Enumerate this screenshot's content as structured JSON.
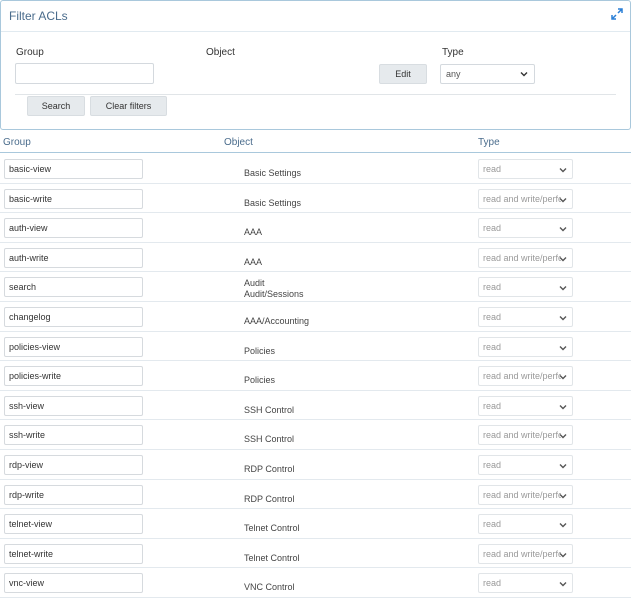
{
  "filter": {
    "title": "Filter ACLs",
    "group_label": "Group",
    "object_label": "Object",
    "type_label": "Type",
    "group_value": "",
    "edit_label": "Edit",
    "type_value": "any",
    "search_label": "Search",
    "clear_label": "Clear filters"
  },
  "table": {
    "headers": {
      "group": "Group",
      "object": "Object",
      "type": "Type"
    },
    "rows": [
      {
        "group": "basic-view",
        "object": "Basic Settings",
        "object2": "",
        "type": "read"
      },
      {
        "group": "basic-write",
        "object": "Basic Settings",
        "object2": "",
        "type": "read and write/perform"
      },
      {
        "group": "auth-view",
        "object": "AAA",
        "object2": "",
        "type": "read"
      },
      {
        "group": "auth-write",
        "object": "AAA",
        "object2": "",
        "type": "read and write/perform"
      },
      {
        "group": "search",
        "object": "Audit",
        "object2": "Audit/Sessions",
        "type": "read"
      },
      {
        "group": "changelog",
        "object": "AAA/Accounting",
        "object2": "",
        "type": "read"
      },
      {
        "group": "policies-view",
        "object": "Policies",
        "object2": "",
        "type": "read"
      },
      {
        "group": "policies-write",
        "object": "Policies",
        "object2": "",
        "type": "read and write/perform"
      },
      {
        "group": "ssh-view",
        "object": "SSH Control",
        "object2": "",
        "type": "read"
      },
      {
        "group": "ssh-write",
        "object": "SSH Control",
        "object2": "",
        "type": "read and write/perform"
      },
      {
        "group": "rdp-view",
        "object": "RDP Control",
        "object2": "",
        "type": "read"
      },
      {
        "group": "rdp-write",
        "object": "RDP Control",
        "object2": "",
        "type": "read and write/perform"
      },
      {
        "group": "telnet-view",
        "object": "Telnet Control",
        "object2": "",
        "type": "read"
      },
      {
        "group": "telnet-write",
        "object": "Telnet Control",
        "object2": "",
        "type": "read and write/perform"
      },
      {
        "group": "vnc-view",
        "object": "VNC Control",
        "object2": "",
        "type": "read"
      }
    ]
  },
  "colors": {
    "accent": "#4a6c8c",
    "border": "#a9c8dc",
    "button_bg": "#e6eaed"
  },
  "icons": {
    "collapse": "collapse-arrows-icon",
    "dropdown": "chevron-down-icon"
  }
}
